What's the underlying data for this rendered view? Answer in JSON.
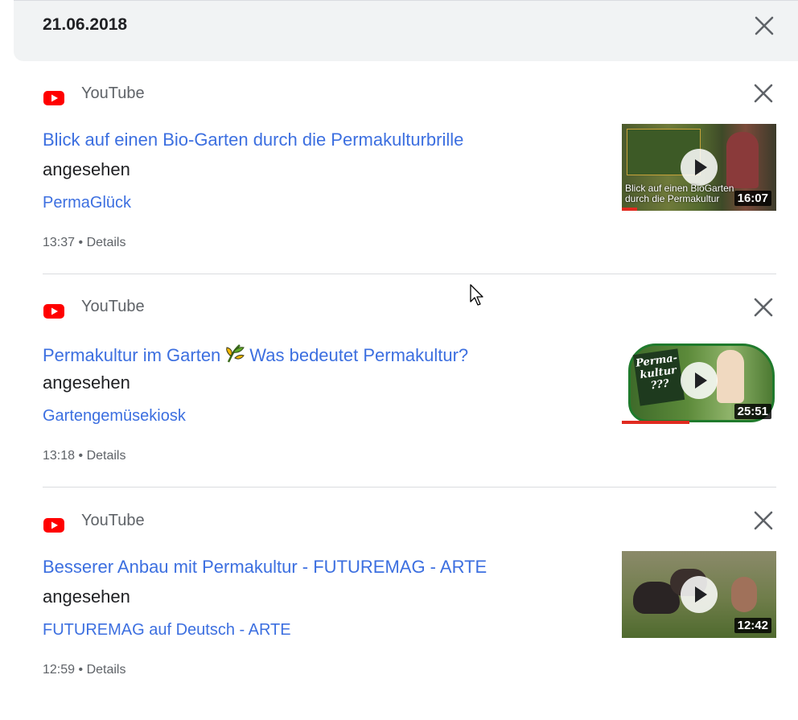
{
  "date_header": {
    "date": "21.06.2018"
  },
  "entries": [
    {
      "source": "YouTube",
      "title": "Blick auf einen Bio-Garten durch die Permakulturbrille",
      "status": "angesehen",
      "channel": "PermaGlück",
      "time": "13:37",
      "separator": "•",
      "details_label": "Details",
      "duration": "16:07",
      "thumb_caption_line1": "Blick auf einen BioGarten",
      "thumb_caption_line2": "durch die Permakultur",
      "watch_progress": 0.1
    },
    {
      "source": "YouTube",
      "title_before": "Permakultur im Garten",
      "title_after": "Was bedeutet Permakultur?",
      "title_icon": "sprout-icon",
      "status": "angesehen",
      "channel": "Gartengemüsekiosk",
      "time": "13:18",
      "separator": "•",
      "details_label": "Details",
      "duration": "25:51",
      "thumb_text": "Perma-kultur ???",
      "watch_progress": 0.44
    },
    {
      "source": "YouTube",
      "title": "Besserer Anbau mit Permakultur - FUTUREMAG - ARTE",
      "status": "angesehen",
      "channel": "FUTUREMAG auf Deutsch - ARTE",
      "time": "12:59",
      "separator": "•",
      "details_label": "Details",
      "duration": "12:42"
    }
  ],
  "colors": {
    "link": "#3c6fe0",
    "youtube_red": "#ff0000",
    "progress_red": "#e02b20",
    "header_bg": "#f1f3f4",
    "muted": "#5f6368"
  },
  "icons": [
    "youtube-logo-icon",
    "close-icon",
    "play-icon",
    "sprout-icon",
    "mouse-pointer-icon"
  ]
}
